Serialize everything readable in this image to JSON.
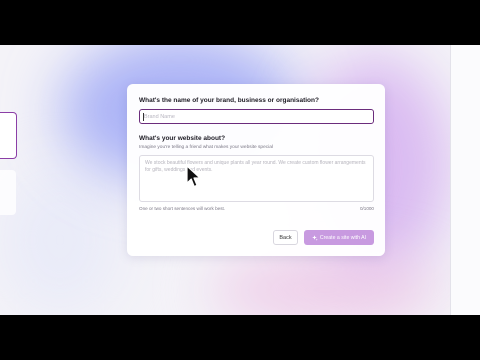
{
  "background": {
    "frame": "#000000",
    "canvas": "#f4f3f8",
    "accent": "#6b2c7c",
    "button": "#c89ae0"
  },
  "form": {
    "brand_question": "What's the name of your brand, business or organisation?",
    "brand_placeholder": "Brand Name",
    "brand_value": "",
    "about_question": "What's your website about?",
    "about_helper": "Imagine you're telling a friend what makes your website special",
    "about_placeholder": "We stock beautiful flowers and unique plants all year round. We create custom flower arrangements for gifts, weddings and events.",
    "about_value": "",
    "hint": "One or two short sentences will work best.",
    "char_count": "0/1000",
    "back_label": "Back",
    "create_label": "Create a site with AI",
    "create_icon": "sparkle-icon"
  },
  "cursor": {
    "icon": "mouse-pointer-icon"
  }
}
